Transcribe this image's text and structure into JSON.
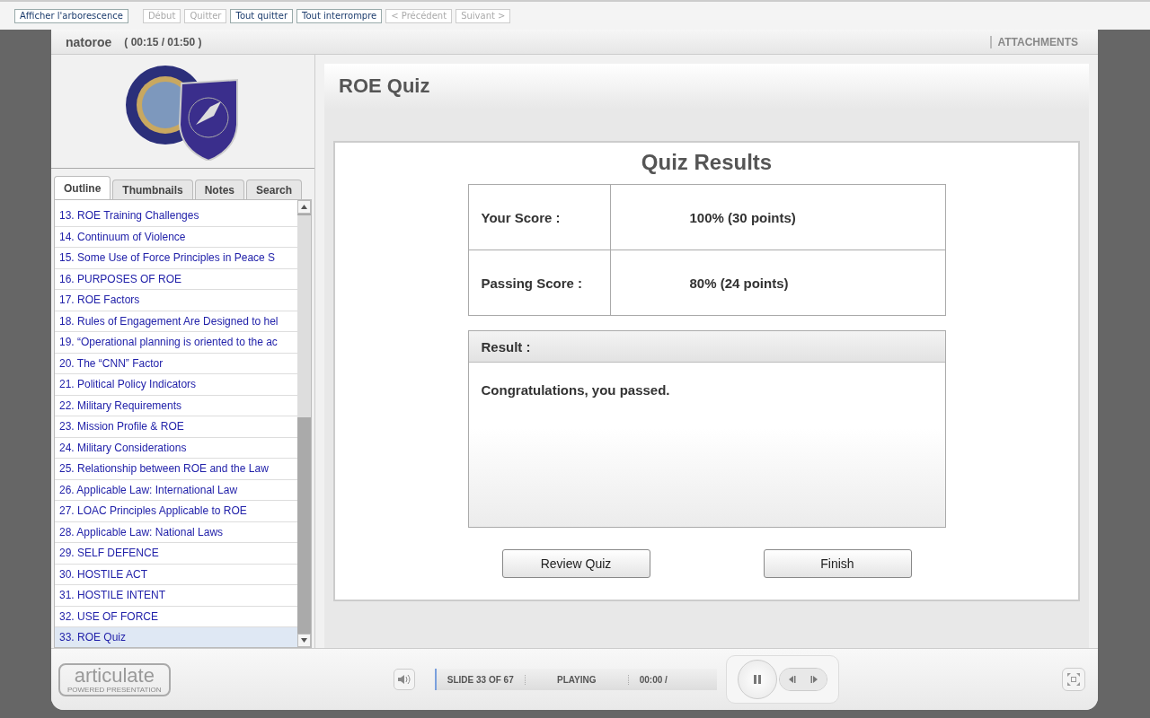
{
  "toolbar": [
    {
      "label": "Afficher l'arborescence",
      "disabled": false
    },
    {
      "label": "Début",
      "disabled": true
    },
    {
      "label": "Quitter",
      "disabled": true
    },
    {
      "label": "Tout quitter",
      "disabled": false
    },
    {
      "label": "Tout interrompre",
      "disabled": false
    },
    {
      "label": "< Précédent",
      "disabled": true
    },
    {
      "label": "Suivant >",
      "disabled": true
    }
  ],
  "player": {
    "title": "natoroe",
    "time": "( 00:15 / 01:50 )",
    "attachments": "ATTACHMENTS"
  },
  "tabs": [
    {
      "label": "Outline",
      "selected": true
    },
    {
      "label": "Thumbnails",
      "selected": false
    },
    {
      "label": "Notes",
      "selected": false
    },
    {
      "label": "Search",
      "selected": false
    }
  ],
  "outline": [
    {
      "label": "13. ROE Training Challenges",
      "selected": false
    },
    {
      "label": "14. Continuum of Violence",
      "selected": false
    },
    {
      "label": "15. Some Use of Force Principles in Peace S",
      "selected": false
    },
    {
      "label": "16. PURPOSES OF ROE",
      "selected": false
    },
    {
      "label": "17. ROE Factors",
      "selected": false
    },
    {
      "label": "18. Rules of Engagement Are Designed to hel",
      "selected": false
    },
    {
      "label": "19. “Operational planning is oriented to the ac",
      "selected": false
    },
    {
      "label": "20. The “CNN” Factor",
      "selected": false
    },
    {
      "label": "21. Political Policy Indicators",
      "selected": false
    },
    {
      "label": "22. Military Requirements",
      "selected": false
    },
    {
      "label": "23. Mission Profile & ROE",
      "selected": false
    },
    {
      "label": "24. Military Considerations",
      "selected": false
    },
    {
      "label": "25. Relationship between ROE and the Law",
      "selected": false
    },
    {
      "label": "26. Applicable Law: International Law",
      "selected": false
    },
    {
      "label": "27. LOAC Principles Applicable to ROE",
      "selected": false
    },
    {
      "label": "28. Applicable Law:  National Laws",
      "selected": false
    },
    {
      "label": "29. SELF DEFENCE",
      "selected": false
    },
    {
      "label": "30. HOSTILE ACT",
      "selected": false
    },
    {
      "label": "31. HOSTILE INTENT",
      "selected": false
    },
    {
      "label": "32. USE OF FORCE",
      "selected": false
    },
    {
      "label": "33. ROE Quiz",
      "selected": true
    }
  ],
  "slide": {
    "title": "ROE Quiz",
    "heading": "Quiz Results",
    "scores": [
      {
        "label": "Your Score :",
        "value": "100% (30 points)"
      },
      {
        "label": "Passing Score :",
        "value": "80%  (24 points)"
      }
    ],
    "result_label": "Result :",
    "result_text": "Congratulations, you passed.",
    "buttons": [
      "Review Quiz",
      "Finish"
    ]
  },
  "controls": {
    "logo": "articulate",
    "logo_sub": "POWERED PRESENTATION",
    "slide_counter": "SLIDE 33 OF 67",
    "status": "PLAYING",
    "elapsed": "00:00 /"
  }
}
